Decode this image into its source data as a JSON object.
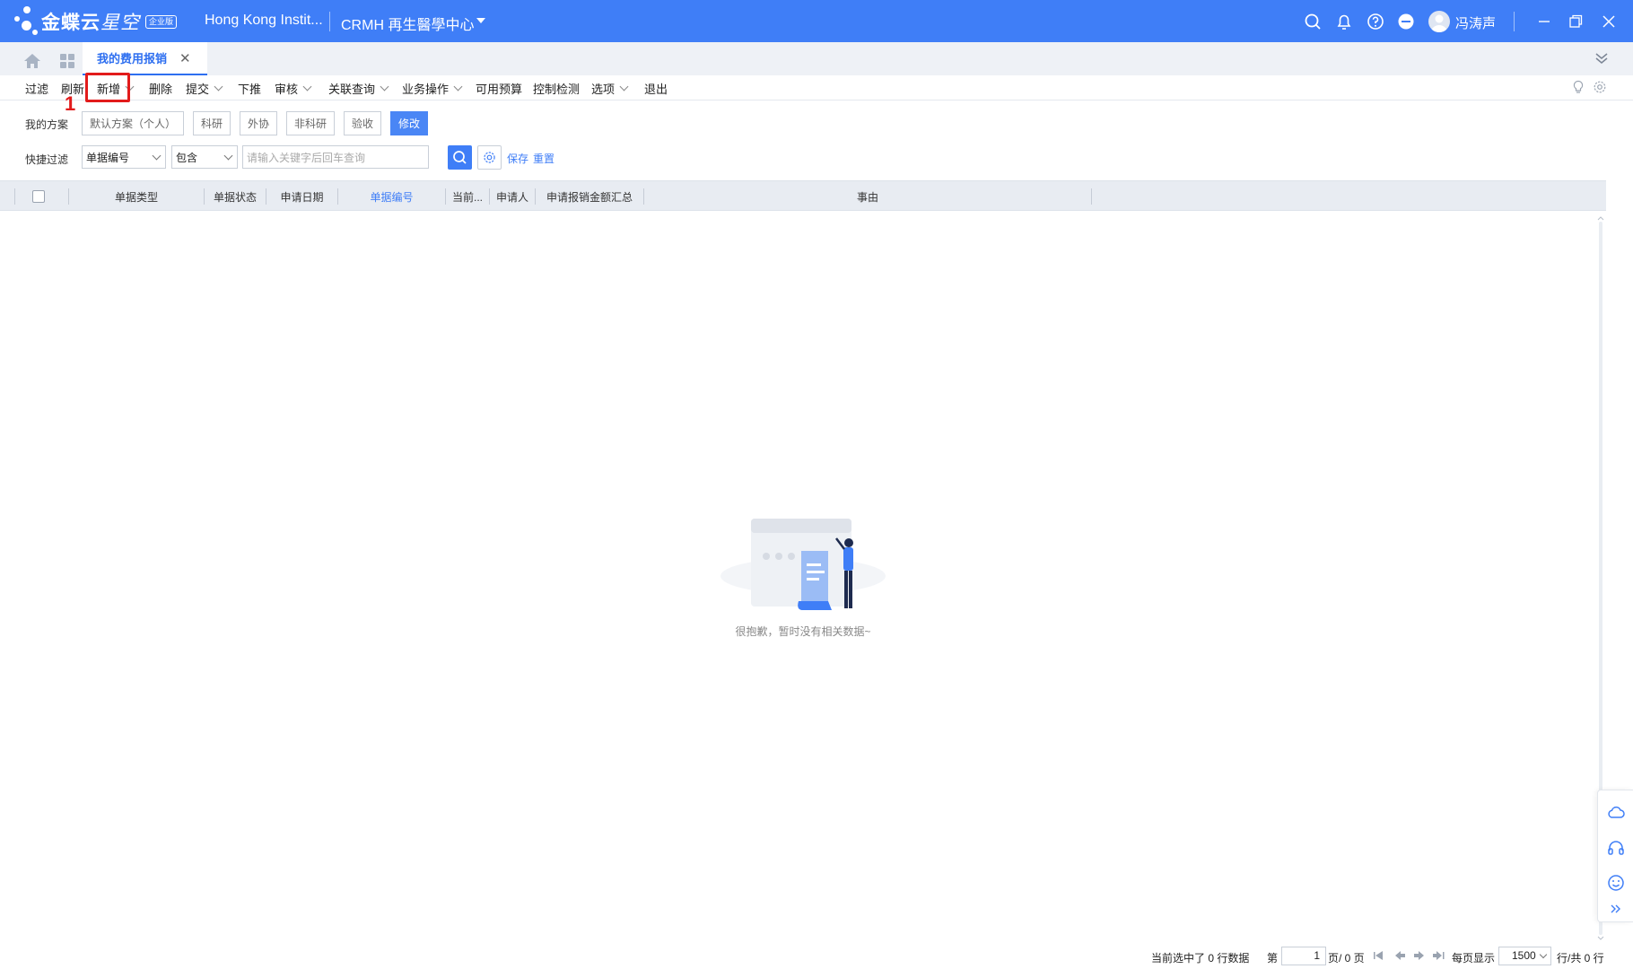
{
  "app": {
    "logo_text_bold": "金蝶云",
    "logo_text_light": "星空",
    "logo_badge": "企业版",
    "org_name": "Hong Kong Instit...",
    "org_unit": "CRMH 再生醫學中心",
    "user_name": "冯涛声",
    "accent": "#3f7ef7"
  },
  "tabs": {
    "active_label": "我的费用报销",
    "close_glyph": "✕"
  },
  "toolbar": {
    "items": [
      "过滤",
      "刷新",
      "新增",
      "删除",
      "提交",
      "下推",
      "审核",
      "关联查询",
      "业务操作",
      "可用预算",
      "控制检测",
      "选项",
      "退出"
    ],
    "annotation_number": "1"
  },
  "filter": {
    "scheme_label": "我的方案",
    "schemes": [
      "默认方案（个人）",
      "科研",
      "外协",
      "非科研",
      "验收",
      "修改"
    ],
    "quick_label": "快捷过滤",
    "field_select": "单据编号",
    "operator_select": "包含",
    "search_placeholder": "请输入关键字后回车查询",
    "save_link": "保存",
    "reset_link": "重置"
  },
  "grid": {
    "columns": [
      "单据类型",
      "单据状态",
      "申请日期",
      "单据编号",
      "当前...",
      "申请人",
      "申请报销金额汇总",
      "事由"
    ],
    "empty_message": "很抱歉，暂时没有相关数据~"
  },
  "footer": {
    "selected_text": "当前选中了 0 行数据",
    "page_prefix": "第",
    "page_value": "1",
    "page_suffix": "页/ 0 页",
    "page_size_label": "每页显示",
    "page_size_value": "1500",
    "total_text": "行/共 0 行"
  }
}
